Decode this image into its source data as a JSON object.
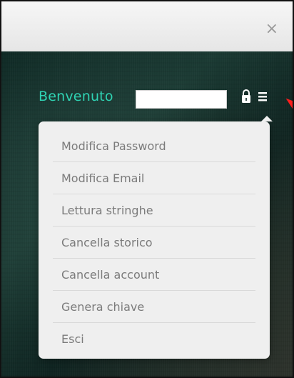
{
  "header": {
    "close_glyph": "×"
  },
  "user_area": {
    "welcome_label": "Benvenuto",
    "username_value": ""
  },
  "menu": {
    "items": [
      {
        "label": "Modifica Password"
      },
      {
        "label": "Modifica Email"
      },
      {
        "label": "Lettura stringhe"
      },
      {
        "label": "Cancella storico"
      },
      {
        "label": "Cancella account"
      },
      {
        "label": "Genera chiave"
      },
      {
        "label": "Esci"
      }
    ]
  },
  "icons": {
    "close": "close-icon",
    "lock_menu": "lock-list-icon",
    "pointer": "pointer-arrow"
  },
  "colors": {
    "accent_teal": "#2fd3b3",
    "menu_bg": "#efefef",
    "menu_text": "#7b7b7b",
    "pointer_red": "#ff1d1d"
  }
}
